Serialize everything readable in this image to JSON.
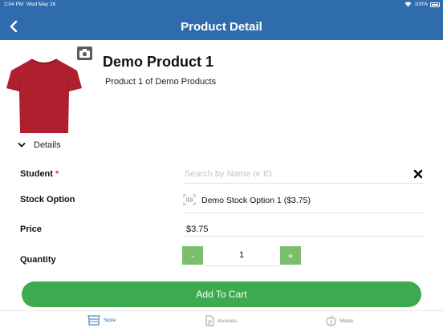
{
  "status_bar": {
    "time": "2:04 PM",
    "date": "Wed May 26",
    "battery": "100%"
  },
  "header": {
    "title": "Product Detail",
    "back_icon": "chevron-left-icon"
  },
  "product": {
    "name": "Demo Product 1",
    "description": "Product 1 of Demo Products",
    "image": "red-tshirt-image",
    "camera_icon": "camera-icon"
  },
  "details": {
    "label": "Details",
    "icon": "chevron-down-icon"
  },
  "form": {
    "student_label": "Student",
    "required_mark": "*",
    "student_placeholder": "Search by Name or ID",
    "student_value": "",
    "clear_icon": "close-icon",
    "stock_label": "Stock Option",
    "stock_value": "Demo Stock Option 1 ($3.75)",
    "stock_icon": "barcode-icon",
    "price_label": "Price",
    "price_value": "$3.75",
    "quantity_label": "Quantity",
    "quantity_value": "1",
    "decrement_label": "-",
    "increment_label": "+"
  },
  "add_to_cart_label": "Add To Cart",
  "colors": {
    "header": "#2f6cae",
    "accent_green": "#3daa4f",
    "stepper_green": "#7bbf6e",
    "required": "#dd3333"
  },
  "tabs": [
    {
      "label": "Store",
      "icon": "store-icon",
      "active": true
    },
    {
      "label": "Invoices",
      "icon": "invoice-icon",
      "active": false
    },
    {
      "label": "Meals",
      "icon": "apple-icon",
      "active": false
    }
  ]
}
